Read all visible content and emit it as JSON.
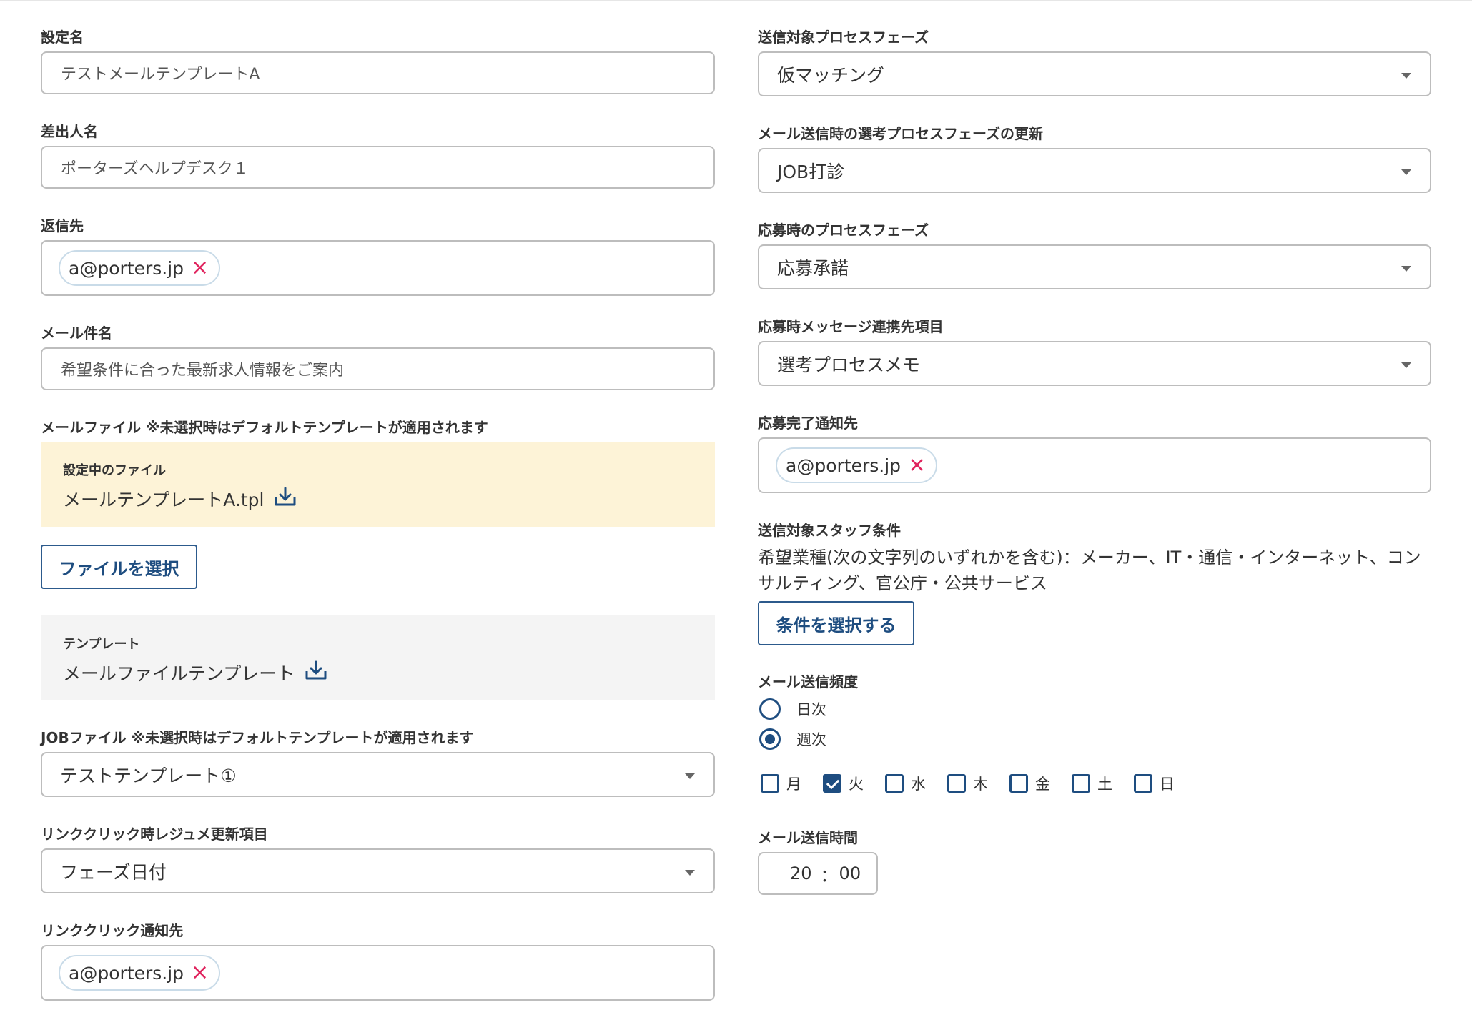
{
  "left": {
    "setting_name": {
      "label": "設定名",
      "value": "テストメールテンプレートA"
    },
    "sender_name": {
      "label": "差出人名",
      "value": "ポーターズヘルプデスク１"
    },
    "reply_to": {
      "label": "返信先",
      "tag": "a@porters.jp",
      "remove_icon": "×"
    },
    "subject": {
      "label": "メール件名",
      "value": "希望条件に合った最新求人情報をご案内"
    },
    "mail_file": {
      "label": "メールファイル ※未選択時はデフォルトテンプレートが適用されます",
      "current_label": "設定中のファイル",
      "current_file": "メールテンプレートA.tpl",
      "select_button": "ファイルを選択",
      "template_label": "テンプレート",
      "template_file": "メールファイルテンプレート"
    },
    "job_file": {
      "label": "JOBファイル ※未選択時はデフォルトテンプレートが適用されます",
      "value": "テストテンプレート①"
    },
    "link_resume_update": {
      "label": "リンククリック時レジュメ更新項目",
      "value": "フェーズ日付"
    },
    "link_notify": {
      "label": "リンククリック通知先",
      "tag": "a@porters.jp",
      "remove_icon": "×"
    }
  },
  "right": {
    "target_phase": {
      "label": "送信対象プロセスフェーズ",
      "value": "仮マッチング"
    },
    "update_phase": {
      "label": "メール送信時の選考プロセスフェーズの更新",
      "value": "JOB打診"
    },
    "apply_phase": {
      "label": "応募時のプロセスフェーズ",
      "value": "応募承諾"
    },
    "apply_message": {
      "label": "応募時メッセージ連携先項目",
      "value": "選考プロセスメモ"
    },
    "apply_notify": {
      "label": "応募完了通知先",
      "tag": "a@porters.jp",
      "remove_icon": "×"
    },
    "staff_condition": {
      "label": "送信対象スタッフ条件",
      "text_line1": "希望業種(次の文字列のいずれかを含む)：メーカー、IT・通信・インターネット、コン",
      "text_line2": "サルティング、官公庁・公共サービス",
      "button": "条件を選択する"
    },
    "frequency": {
      "label": "メール送信頻度",
      "options": [
        "日次",
        "週次"
      ],
      "selected": "週次",
      "days": [
        "月",
        "火",
        "水",
        "木",
        "金",
        "土",
        "日"
      ],
      "checked_days": [
        "火"
      ]
    },
    "send_time": {
      "label": "メール送信時間",
      "hour": "20",
      "sep": "：",
      "minute": "00"
    }
  },
  "colors": {
    "accent": "#1e4d80",
    "tag_remove": "#e0245e",
    "file_panel_bg": "#fdf3d7",
    "template_panel_bg": "#f4f4f4"
  },
  "icons": {
    "download": "download-icon",
    "select_caret": "chevron-down-icon"
  }
}
